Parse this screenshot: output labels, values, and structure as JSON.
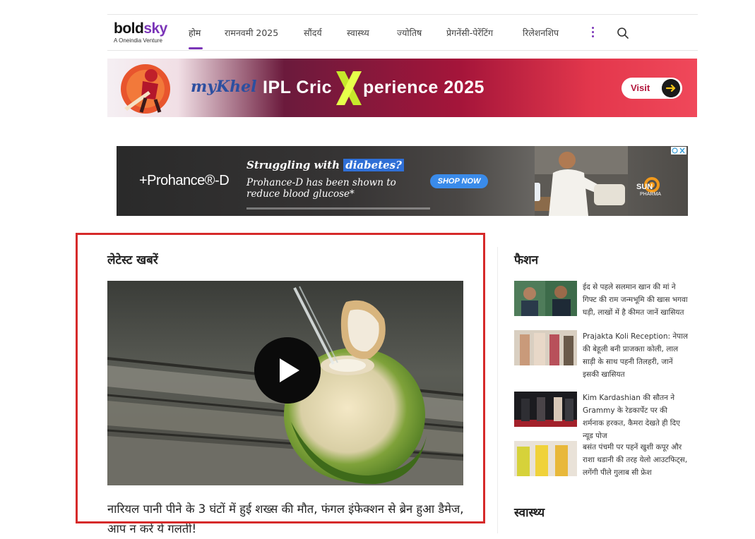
{
  "header": {
    "logo_main_1": "bold",
    "logo_main_2": "sky",
    "logo_sub": "A Oneindia Venture",
    "nav": [
      {
        "label": "होम",
        "active": true
      },
      {
        "label": "रामनवमी 2025"
      },
      {
        "label": "सौंदर्य"
      },
      {
        "label": "स्वास्थ्य"
      },
      {
        "label": "ज्योतिष"
      },
      {
        "label": "प्रेगनेंसी-पेरेंटिंग"
      },
      {
        "label": "रिलेशनशिप"
      }
    ],
    "more_icon": "more-vertical-icon",
    "search_icon": "search-icon",
    "accent_color": "#7b35b8"
  },
  "ads": {
    "mykhel": {
      "brand": "myKhel",
      "title_1": "IPL Cric",
      "title_2": "perience 2025",
      "visit_label": "Visit"
    },
    "prohance": {
      "brand": "+Prohance®-D",
      "headline_pre": "Struggling with",
      "headline_highlight": "diabetes?",
      "body": "Prohance-D has been shown to reduce blood glucose*",
      "cta": "SHOP NOW",
      "sponsor": "SUN",
      "sponsor_sub": "PHARMA"
    }
  },
  "latest": {
    "heading": "लेटेस्ट खबरें",
    "featured": {
      "title": "नारियल पानी पीने के 3 घंटों में हुई शख्स की मौत, फंगल इंफेक्शन से ब्रेन हुआ डैमेज, आप न करें ये गलती!",
      "image": "coconut-water-photo",
      "play_icon": "play-icon"
    }
  },
  "sidebar": {
    "fashion_heading": "फैशन",
    "health_heading": "स्वास्थ्य",
    "items": [
      {
        "text": "ईद से पहले सलमान खान की मां ने गिफ्ट की राम जन्मभूमि की खास भगवा घड़ी, लाखों में है कीमत जानें खासियत"
      },
      {
        "text": "Prajakta Koli Reception: नेपाल की बेहूली बनी प्राजक्ता कोली, लाल साड़ी के साथ पहनी तिलहरी, जानें इसकी खासियत"
      },
      {
        "text": "Kim Kardashian की सौतन ने Grammy के रेडकार्पेट पर की शर्मनाक हरकत, कैमरा देखते ही दिए न्यूड पोज"
      },
      {
        "text": "बसंत पंचमी पर पहनें खुशी कपूर और राशा थडानी की तरह येलो आउटफिट्स, लगेंगी पीले गुलाब सी फ्रेश"
      }
    ]
  },
  "highlight_color": "#d62a2a"
}
